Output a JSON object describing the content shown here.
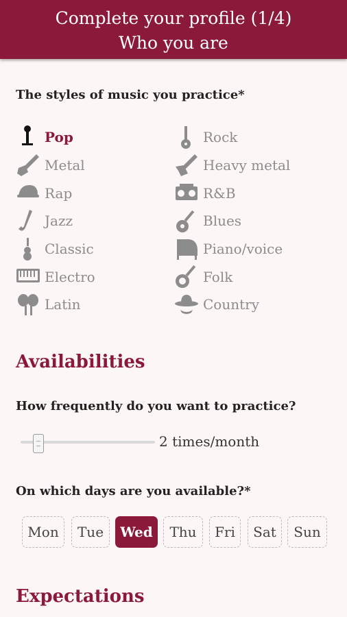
{
  "header": {
    "title_line1": "Complete your profile (1/4)",
    "title_line2": "Who you are"
  },
  "styles_question": "The styles of music you practice*",
  "styles": [
    {
      "label": "Pop",
      "icon": "microphone-icon",
      "selected": true
    },
    {
      "label": "Rock",
      "icon": "electric-guitar-icon",
      "selected": false
    },
    {
      "label": "Metal",
      "icon": "metal-guitar-icon",
      "selected": false
    },
    {
      "label": "Heavy metal",
      "icon": "flying-v-guitar-icon",
      "selected": false
    },
    {
      "label": "Rap",
      "icon": "cap-icon",
      "selected": false
    },
    {
      "label": "R&B",
      "icon": "boombox-icon",
      "selected": false
    },
    {
      "label": "Jazz",
      "icon": "saxophone-icon",
      "selected": false
    },
    {
      "label": "Blues",
      "icon": "acoustic-guitar-icon",
      "selected": false
    },
    {
      "label": "Classic",
      "icon": "violin-icon",
      "selected": false
    },
    {
      "label": "Piano/voice",
      "icon": "piano-icon",
      "selected": false
    },
    {
      "label": "Electro",
      "icon": "keyboard-icon",
      "selected": false
    },
    {
      "label": "Folk",
      "icon": "banjo-icon",
      "selected": false
    },
    {
      "label": "Latin",
      "icon": "maracas-icon",
      "selected": false
    },
    {
      "label": "Country",
      "icon": "cowboy-hat-icon",
      "selected": false
    }
  ],
  "availabilities": {
    "heading": "Availabilities",
    "frequency_question": "How frequently do you want to practice?",
    "frequency_value": "2 times/month",
    "frequency_level": 0.1,
    "days_question": "On which days are you available?*",
    "days": [
      {
        "label": "Mon",
        "selected": false
      },
      {
        "label": "Tue",
        "selected": false
      },
      {
        "label": "Wed",
        "selected": true
      },
      {
        "label": "Thu",
        "selected": false
      },
      {
        "label": "Fri",
        "selected": false
      },
      {
        "label": "Sat",
        "selected": false
      },
      {
        "label": "Sun",
        "selected": false
      }
    ]
  },
  "expectations": {
    "heading": "Expectations"
  },
  "colors": {
    "accent": "#8b1a3a",
    "muted": "#8c8c8c",
    "background": "#fdf6f6"
  }
}
